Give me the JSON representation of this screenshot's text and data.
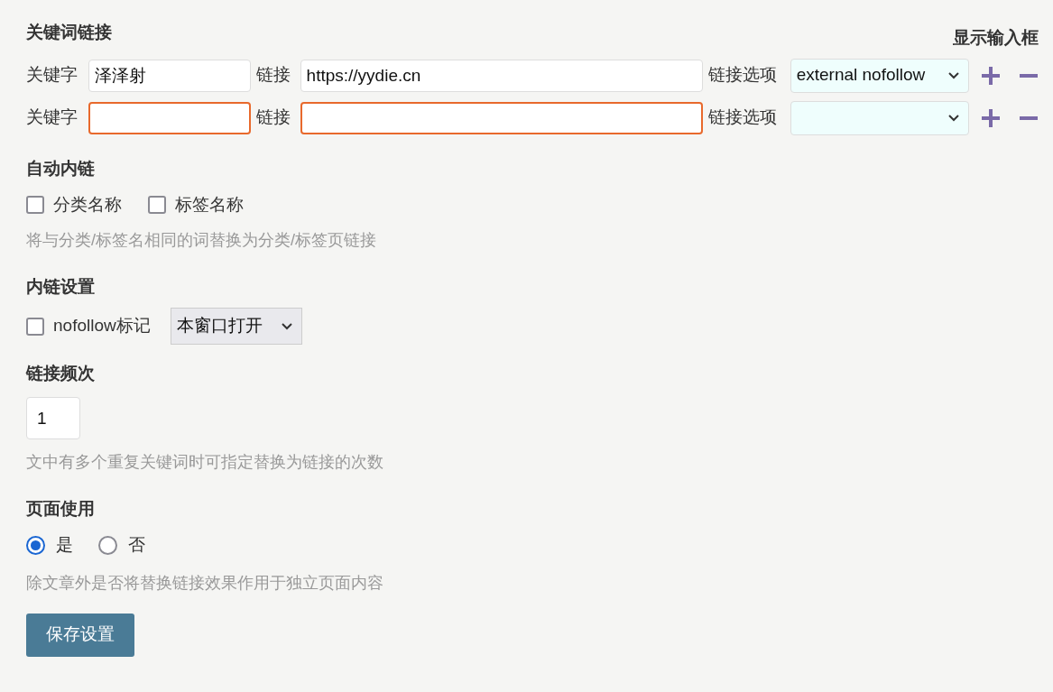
{
  "keyword_links": {
    "title": "关键词链接",
    "toggle_label": "显示输入框",
    "rows": [
      {
        "keyword_label": "关键字",
        "keyword": "泽泽射",
        "link_label": "链接",
        "link": "https://yydie.cn",
        "option_label": "链接选项",
        "option": "external nofollow",
        "invalid": false
      },
      {
        "keyword_label": "关键字",
        "link_label": "链接",
        "option_label": "链接选项",
        "invalid": true
      }
    ]
  },
  "auto_inner_link": {
    "title": "自动内链",
    "checkboxes": [
      {
        "label": "分类名称",
        "checked": false
      },
      {
        "label": "标签名称",
        "checked": false
      }
    ],
    "hint": "将与分类/标签名相同的词替换为分类/标签页链接"
  },
  "inner_link_settings": {
    "title": "内链设置",
    "checkbox": {
      "label": "nofollow标记",
      "checked": false
    },
    "target": "本窗口打开"
  },
  "link_frequency": {
    "title": "链接频次",
    "value": "1",
    "hint": "文中有多个重复关键词时可指定替换为链接的次数"
  },
  "page_use": {
    "title": "页面使用",
    "radios": [
      {
        "label": "是",
        "selected": true
      },
      {
        "label": "否",
        "selected": false
      }
    ],
    "hint": "除文章外是否将替换链接效果作用于独立页面内容"
  },
  "save_button": "保存设置"
}
